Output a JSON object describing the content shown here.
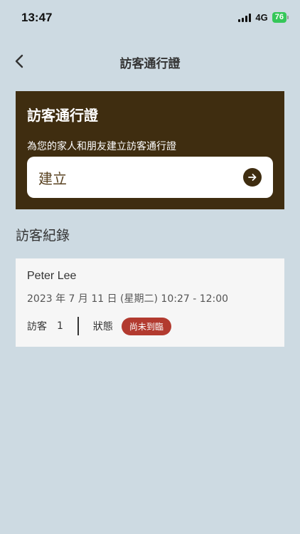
{
  "status_bar": {
    "time": "13:47",
    "network": "4G",
    "battery": "76"
  },
  "nav": {
    "title": "訪客通行證"
  },
  "create_card": {
    "title": "訪客通行證",
    "description": "為您的家人和朋友建立訪客通行證",
    "button_label": "建立"
  },
  "records": {
    "section_title": "訪客紀錄",
    "items": [
      {
        "name": "Peter Lee",
        "datetime": "2023 年 7 月 11 日 (星期二) 10:27 - 12:00",
        "visitor_label": "訪客",
        "visitor_count": "1",
        "status_label": "狀態",
        "status_value": "尚未到臨"
      }
    ]
  },
  "colors": {
    "background": "#cddae2",
    "card_brown": "#3f2d10",
    "status_red": "#b23a2f",
    "battery_green": "#35c759"
  },
  "icons": {
    "back": "chevron-left-icon",
    "create": "arrow-right-circle-icon",
    "signal": "signal-icon",
    "battery": "battery-icon"
  }
}
